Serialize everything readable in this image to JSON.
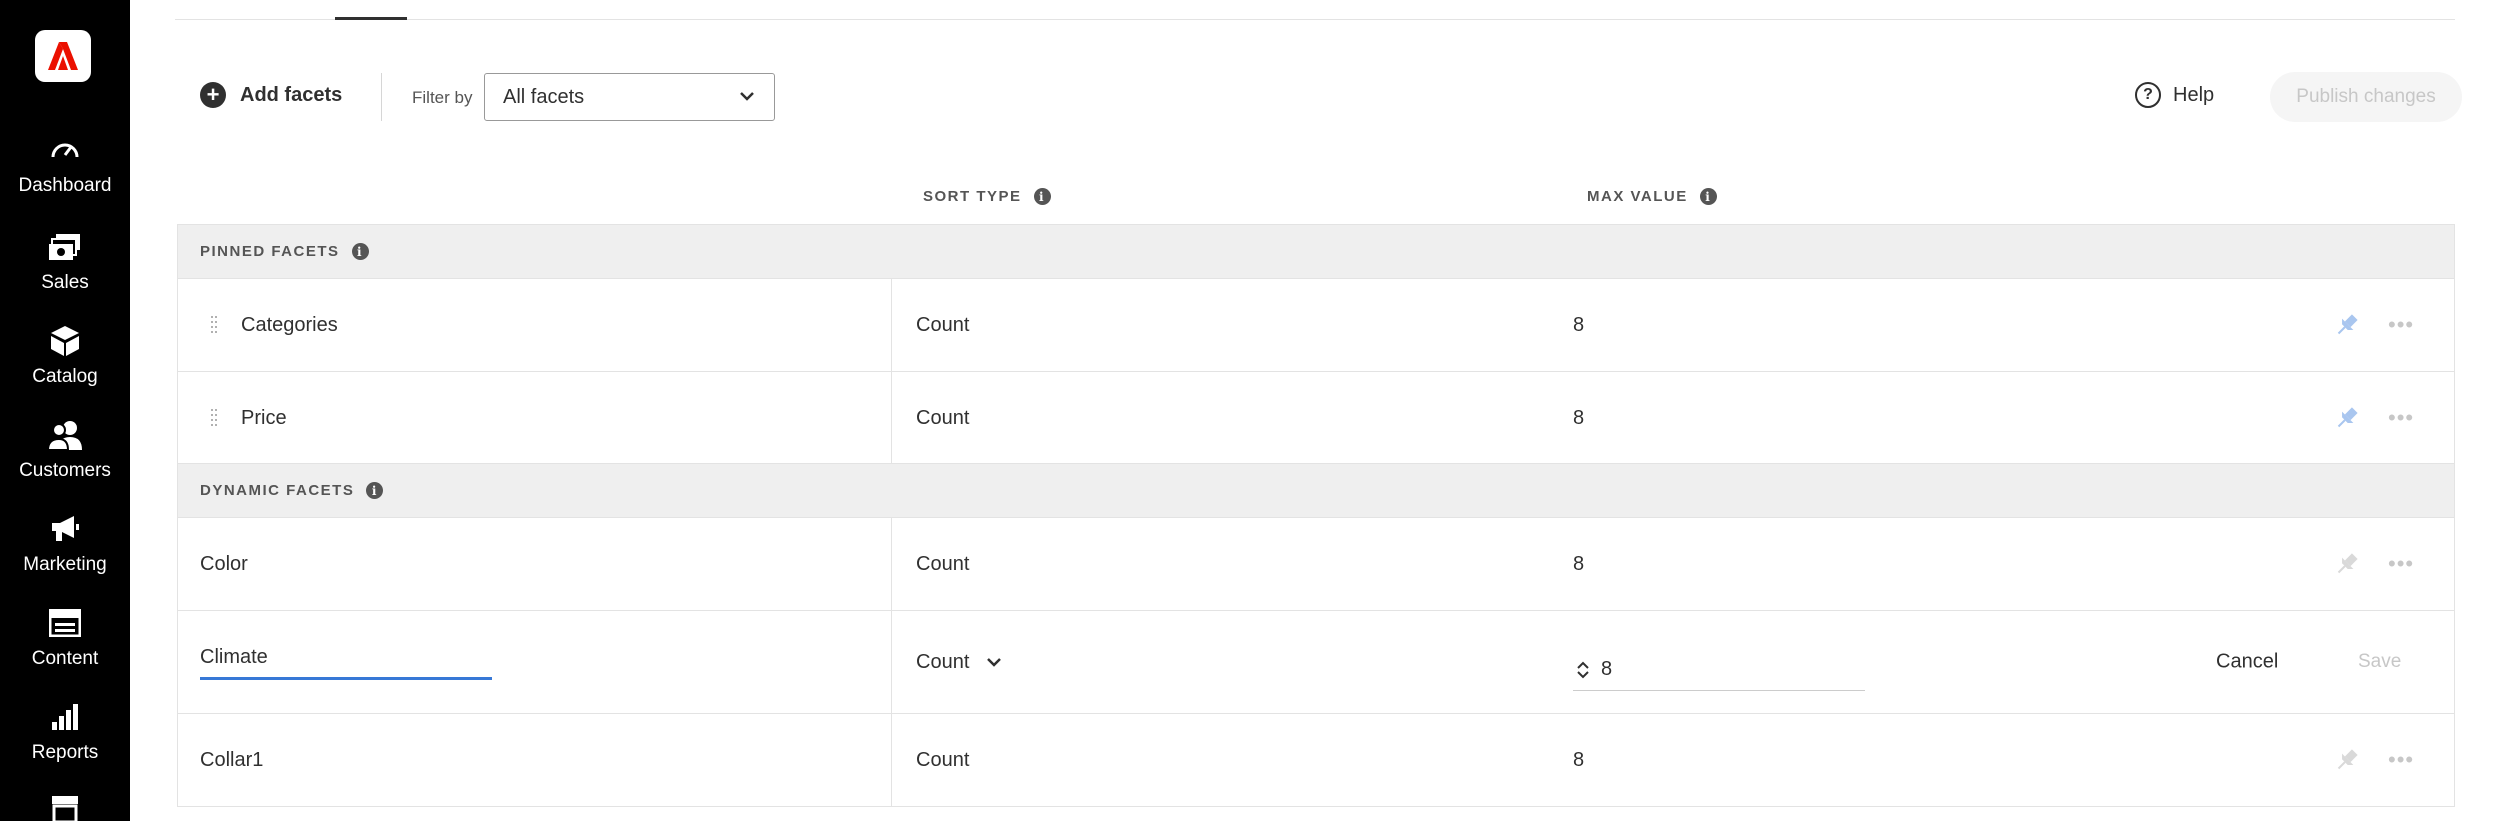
{
  "sidebar": {
    "logo_icon": "adobe-commerce-logo",
    "items": [
      {
        "label": "Dashboard",
        "icon": "speedometer-icon"
      },
      {
        "label": "Sales",
        "icon": "dollar-bills-icon"
      },
      {
        "label": "Catalog",
        "icon": "box-icon"
      },
      {
        "label": "Customers",
        "icon": "users-icon"
      },
      {
        "label": "Marketing",
        "icon": "megaphone-icon"
      },
      {
        "label": "Content",
        "icon": "layout-icon"
      },
      {
        "label": "Reports",
        "icon": "bar-chart-icon"
      },
      {
        "label": "",
        "icon": "store-icon"
      }
    ]
  },
  "toolbar": {
    "add_facets_label": "Add facets",
    "filter_label": "Filter by",
    "filter_value": "All facets",
    "help_label": "Help",
    "publish_label": "Publish changes"
  },
  "columns": {
    "sort_type": "SORT TYPE",
    "max_value": "MAX VALUE"
  },
  "groups": {
    "pinned": "PINNED FACETS",
    "dynamic": "DYNAMIC FACETS"
  },
  "pinned_rows": [
    {
      "name": "Categories",
      "sort": "Count",
      "max": "8"
    },
    {
      "name": "Price",
      "sort": "Count",
      "max": "8"
    }
  ],
  "dynamic_rows": [
    {
      "name": "Color",
      "sort": "Count",
      "max": "8"
    },
    {
      "name": "Collar1",
      "sort": "Count",
      "max": "8"
    }
  ],
  "edit_row": {
    "name_value": "Climate",
    "sort_value": "Count",
    "max_value": "8",
    "cancel_label": "Cancel",
    "save_label": "Save"
  },
  "colors": {
    "brand": "#eb1000",
    "pinned_icon": "#a9c6ef",
    "inactive_icon": "#d9d9d9",
    "focus_underline": "#3778d6"
  }
}
